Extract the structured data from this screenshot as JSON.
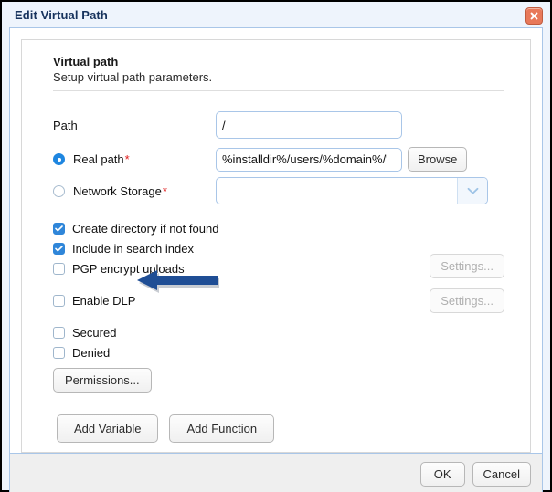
{
  "window": {
    "title": "Edit Virtual Path",
    "close_icon": "close-icon"
  },
  "section": {
    "title": "Virtual path",
    "subtitle": "Setup virtual path parameters."
  },
  "form": {
    "path": {
      "label": "Path",
      "value": "/",
      "placeholder": ""
    },
    "real_path": {
      "label": "Real path",
      "required_marker": "*",
      "value": "%installdir%/users/%domain%/'",
      "selected": true,
      "browse_label": "Browse"
    },
    "network_storage": {
      "label": "Network Storage",
      "required_marker": "*",
      "value": "",
      "selected": false,
      "dropdown_icon": "chevron-down-icon"
    },
    "checkboxes": [
      {
        "label": "Create directory if not found",
        "checked": true
      },
      {
        "label": "Include in search index",
        "checked": true
      },
      {
        "label": "PGP encrypt uploads",
        "checked": false
      },
      {
        "label": "Enable DLP",
        "checked": false
      },
      {
        "label": "Secured",
        "checked": false
      },
      {
        "label": "Denied",
        "checked": false
      }
    ],
    "settings_buttons": [
      {
        "label": "Settings...",
        "enabled": false
      },
      {
        "label": "Settings...",
        "enabled": false
      }
    ],
    "permissions_button": {
      "label": "Permissions..."
    }
  },
  "actions": {
    "add_variable": "Add Variable",
    "add_function": "Add Function"
  },
  "footer": {
    "ok": "OK",
    "cancel": "Cancel"
  },
  "annotation": {
    "arrow_icon": "left-arrow-annotation",
    "color": "#1f4e95",
    "points_at": "Enable DLP"
  },
  "colors": {
    "title_text": "#16325c",
    "accent_blue": "#2f86d9",
    "required_red": "#e01b1b",
    "close_button": "#e8795a",
    "input_border": "#a9c6e8",
    "window_bg": "#eef4fc"
  }
}
